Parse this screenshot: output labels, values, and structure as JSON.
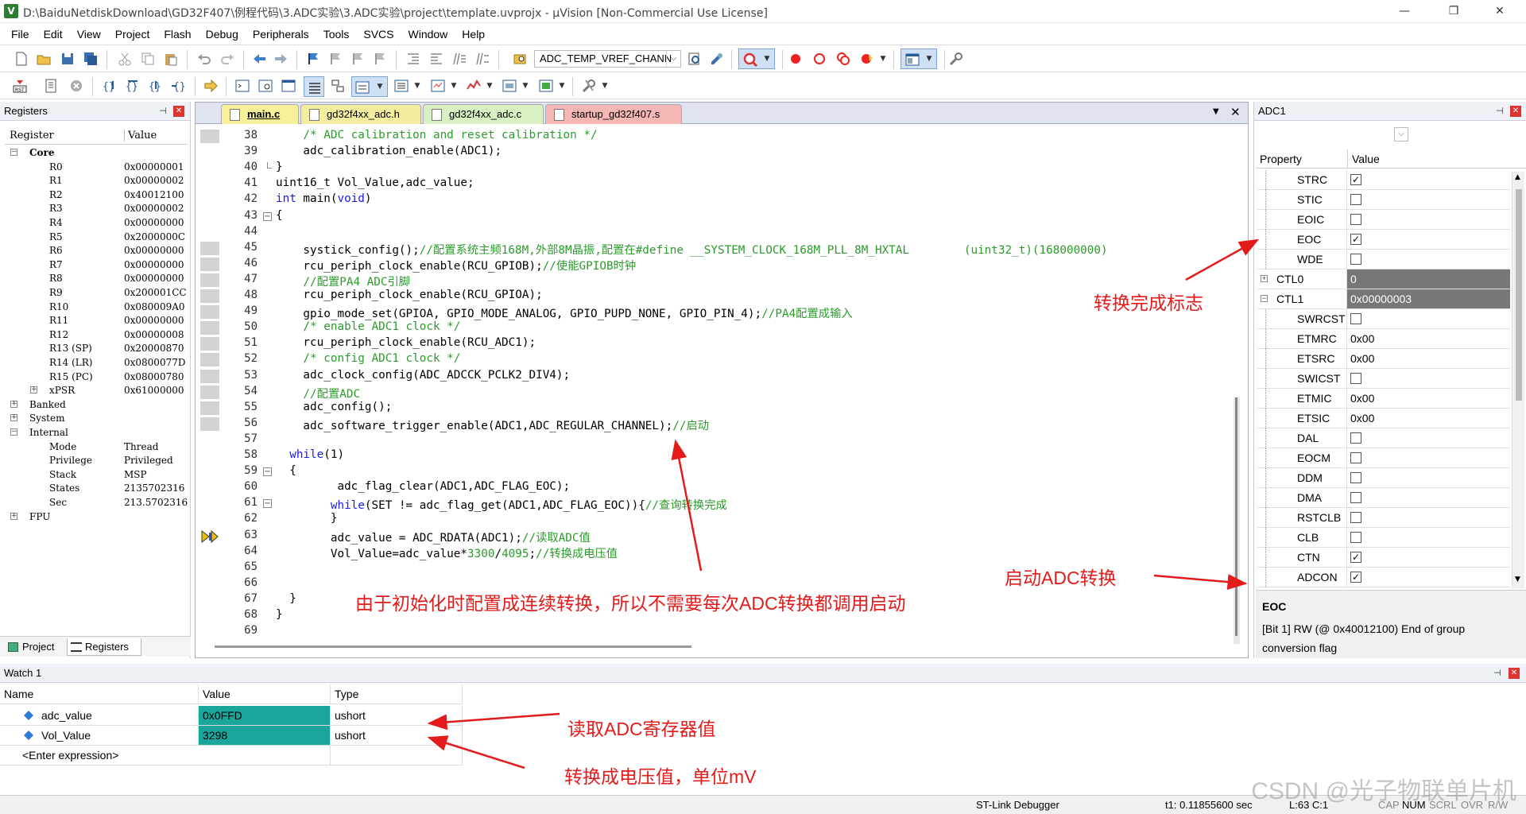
{
  "window": {
    "title": "D:\\BaiduNetdiskDownload\\GD32F407\\例程代码\\3.ADC实验\\3.ADC实验\\project\\template.uvprojx - µVision  [Non-Commercial Use License]",
    "logo_letter": "V",
    "min_glyph": "—",
    "max_glyph": "❐",
    "close_glyph": "✕"
  },
  "menu": [
    "File",
    "Edit",
    "View",
    "Project",
    "Flash",
    "Debug",
    "Peripherals",
    "Tools",
    "SVCS",
    "Window",
    "Help"
  ],
  "toolbar": {
    "target": "ADC_TEMP_VREF_CHANN",
    "arrow": "⌵"
  },
  "registers": {
    "title": "Registers",
    "col_register": "Register",
    "col_value": "Value",
    "core": "Core",
    "items": [
      {
        "name": "R0",
        "value": "0x00000001"
      },
      {
        "name": "R1",
        "value": "0x00000002"
      },
      {
        "name": "R2",
        "value": "0x40012100"
      },
      {
        "name": "R3",
        "value": "0x00000002"
      },
      {
        "name": "R4",
        "value": "0x00000000"
      },
      {
        "name": "R5",
        "value": "0x2000000C"
      },
      {
        "name": "R6",
        "value": "0x00000000"
      },
      {
        "name": "R7",
        "value": "0x00000000"
      },
      {
        "name": "R8",
        "value": "0x00000000"
      },
      {
        "name": "R9",
        "value": "0x200001CC"
      },
      {
        "name": "R10",
        "value": "0x080009A0"
      },
      {
        "name": "R11",
        "value": "0x00000000"
      },
      {
        "name": "R12",
        "value": "0x00000008"
      },
      {
        "name": "R13 (SP)",
        "value": "0x20000870"
      },
      {
        "name": "R14 (LR)",
        "value": "0x0800077D"
      },
      {
        "name": "R15 (PC)",
        "value": "0x08000780"
      },
      {
        "name": "xPSR",
        "value": "0x61000000"
      }
    ],
    "banked": "Banked",
    "system": "System",
    "internal": "Internal",
    "internal_items": [
      {
        "name": "Mode",
        "value": "Thread"
      },
      {
        "name": "Privilege",
        "value": "Privileged"
      },
      {
        "name": "Stack",
        "value": "MSP"
      },
      {
        "name": "States",
        "value": "2135702316"
      },
      {
        "name": "Sec",
        "value": "213.5702316"
      }
    ],
    "fpu": "FPU",
    "tab_project": "Project",
    "tab_registers": "Registers"
  },
  "editor": {
    "tabs": [
      "main.c",
      "gd32f4xx_adc.h",
      "gd32f4xx_adc.c",
      "startup_gd32f407.s"
    ],
    "lines": [
      {
        "n": "38",
        "segs": [
          [
            "cm",
            "    /* ADC calibration and reset calibration */"
          ]
        ]
      },
      {
        "n": "39",
        "segs": [
          [
            "",
            "    adc_calibration_enable(ADC1);"
          ]
        ]
      },
      {
        "n": "40",
        "segs": [
          [
            "",
            "}"
          ]
        ]
      },
      {
        "n": "41",
        "segs": [
          [
            "",
            "uint16_t Vol_Value,adc_value;"
          ]
        ]
      },
      {
        "n": "42",
        "segs": [
          [
            "kw",
            "int"
          ],
          [
            "",
            " main("
          ],
          [
            "kw",
            "void"
          ],
          [
            "",
            ")"
          ]
        ]
      },
      {
        "n": "43",
        "segs": [
          [
            "",
            "{"
          ]
        ]
      },
      {
        "n": "44",
        "segs": [
          [
            "",
            ""
          ]
        ]
      },
      {
        "n": "45",
        "segs": [
          [
            "",
            "    systick_config();"
          ],
          [
            "cm",
            "//配置系统主频168M,外部8M晶振,配置在#define __SYSTEM_CLOCK_168M_PLL_8M_HXTAL        (uint32_t)(168000000)"
          ]
        ]
      },
      {
        "n": "46",
        "segs": [
          [
            "",
            "    rcu_periph_clock_enable(RCU_GPIOB);"
          ],
          [
            "cm",
            "//使能GPIOB时钟"
          ]
        ]
      },
      {
        "n": "47",
        "segs": [
          [
            "cm",
            "    //配置PA4 ADC引脚"
          ]
        ]
      },
      {
        "n": "48",
        "segs": [
          [
            "",
            "    rcu_periph_clock_enable(RCU_GPIOA);"
          ]
        ]
      },
      {
        "n": "49",
        "segs": [
          [
            "",
            "    gpio_mode_set(GPIOA, GPIO_MODE_ANALOG, GPIO_PUPD_NONE, GPIO_PIN_4);"
          ],
          [
            "cm",
            "//PA4配置成输入"
          ]
        ]
      },
      {
        "n": "50",
        "segs": [
          [
            "cm",
            "    /* enable ADC1 clock */"
          ]
        ]
      },
      {
        "n": "51",
        "segs": [
          [
            "",
            "    rcu_periph_clock_enable(RCU_ADC1);"
          ]
        ]
      },
      {
        "n": "52",
        "segs": [
          [
            "cm",
            "    /* config ADC1 clock */"
          ]
        ]
      },
      {
        "n": "53",
        "segs": [
          [
            "",
            "    adc_clock_config(ADC_ADCCK_PCLK2_DIV4);"
          ]
        ]
      },
      {
        "n": "54",
        "segs": [
          [
            "cm",
            "    //配置ADC"
          ]
        ]
      },
      {
        "n": "55",
        "segs": [
          [
            "",
            "    adc_config();"
          ]
        ]
      },
      {
        "n": "56",
        "segs": [
          [
            "",
            "    adc_software_trigger_enable(ADC1,ADC_REGULAR_CHANNEL);"
          ],
          [
            "cm",
            "//启动"
          ]
        ]
      },
      {
        "n": "57",
        "segs": [
          [
            "",
            ""
          ]
        ]
      },
      {
        "n": "58",
        "segs": [
          [
            "kw",
            "  while"
          ],
          [
            "",
            "(1)"
          ]
        ]
      },
      {
        "n": "59",
        "segs": [
          [
            "",
            "  {"
          ]
        ]
      },
      {
        "n": "60",
        "segs": [
          [
            "",
            "         adc_flag_clear(ADC1,ADC_FLAG_EOC);"
          ]
        ]
      },
      {
        "n": "61",
        "segs": [
          [
            "kw",
            "        while"
          ],
          [
            "",
            "(SET != adc_flag_get(ADC1,ADC_FLAG_EOC)){"
          ],
          [
            "cm",
            "//查询转换完成"
          ]
        ]
      },
      {
        "n": "62",
        "segs": [
          [
            "",
            "        }"
          ]
        ]
      },
      {
        "n": "63",
        "segs": [
          [
            "",
            "        adc_value = ADC_RDATA(ADC1);"
          ],
          [
            "cm",
            "//读取ADC值"
          ]
        ]
      },
      {
        "n": "64",
        "segs": [
          [
            "",
            "        Vol_Value=adc_value*"
          ],
          [
            "num",
            "3300"
          ],
          [
            "",
            "/"
          ],
          [
            "num",
            "4095"
          ],
          [
            "",
            ";"
          ],
          [
            "cm",
            "//转换成电压值"
          ]
        ]
      },
      {
        "n": "65",
        "segs": [
          [
            "",
            ""
          ]
        ]
      },
      {
        "n": "66",
        "segs": [
          [
            "",
            ""
          ]
        ]
      },
      {
        "n": "67",
        "segs": [
          [
            "",
            "  }"
          ]
        ]
      },
      {
        "n": "68",
        "segs": [
          [
            "",
            "}"
          ]
        ]
      },
      {
        "n": "69",
        "segs": [
          [
            "",
            ""
          ]
        ]
      }
    ]
  },
  "adc": {
    "title": "ADC1",
    "col_property": "Property",
    "col_value": "Value",
    "rows": [
      {
        "name": "STRC",
        "type": "check",
        "checked": true
      },
      {
        "name": "STIC",
        "type": "check",
        "checked": false
      },
      {
        "name": "EOIC",
        "type": "check",
        "checked": false
      },
      {
        "name": "EOC",
        "type": "check",
        "checked": true
      },
      {
        "name": "WDE",
        "type": "check",
        "checked": false
      },
      {
        "name": "CTL0",
        "type": "group",
        "value": "0",
        "collapsed": true
      },
      {
        "name": "CTL1",
        "type": "group",
        "value": "0x00000003",
        "collapsed": false
      },
      {
        "name": "SWRCST",
        "type": "check",
        "checked": false
      },
      {
        "name": "ETMRC",
        "type": "text",
        "value": "0x00"
      },
      {
        "name": "ETSRC",
        "type": "text",
        "value": "0x00"
      },
      {
        "name": "SWICST",
        "type": "check",
        "checked": false
      },
      {
        "name": "ETMIC",
        "type": "text",
        "value": "0x00"
      },
      {
        "name": "ETSIC",
        "type": "text",
        "value": "0x00"
      },
      {
        "name": "DAL",
        "type": "check",
        "checked": false
      },
      {
        "name": "EOCM",
        "type": "check",
        "checked": false
      },
      {
        "name": "DDM",
        "type": "check",
        "checked": false
      },
      {
        "name": "DMA",
        "type": "check",
        "checked": false
      },
      {
        "name": "RSTCLB",
        "type": "check",
        "checked": false
      },
      {
        "name": "CLB",
        "type": "check",
        "checked": false
      },
      {
        "name": "CTN",
        "type": "check",
        "checked": true
      },
      {
        "name": "ADCON",
        "type": "check",
        "checked": true
      }
    ],
    "desc_title": "EOC",
    "desc_text": "[Bit 1] RW (@ 0x40012100) End of group conversion flag"
  },
  "watch": {
    "title": "Watch 1",
    "col_name": "Name",
    "col_value": "Value",
    "col_type": "Type",
    "rows": [
      {
        "name": "adc_value",
        "value": "0x0FFD",
        "type": "ushort"
      },
      {
        "name": "Vol_Value",
        "value": "3298",
        "type": "ushort"
      }
    ],
    "enter": "<Enter expression>"
  },
  "annotations": {
    "conv_flag": "转换完成标志",
    "start_adc": "启动ADC转换",
    "continuous": "由于初始化时配置成连续转换，所以不需要每次ADC转换都调用启动",
    "read_reg": "读取ADC寄存器值",
    "to_mv": "转换成电压值，单位mV"
  },
  "status": {
    "debugger": "ST-Link Debugger",
    "time": "t1: 0.11855600 sec",
    "pos": "L:63 C:1",
    "caps": "CAP",
    "num": "NUM",
    "scrl": "SCRL",
    "ovr": "OVR",
    "rw": "R/W"
  },
  "watermark": "CSDN @光子物联单片机",
  "colors": {
    "accent": "#1a1af2",
    "comment": "#2b9b2b",
    "annotation": "#e31b1b",
    "watch_value_bg": "#1aa69a",
    "active_tab": "#f7f29a",
    "tab_yellow": "#f3ed9f",
    "tab_green": "#d9f0c2",
    "tab_red": "#f4b7b4"
  }
}
